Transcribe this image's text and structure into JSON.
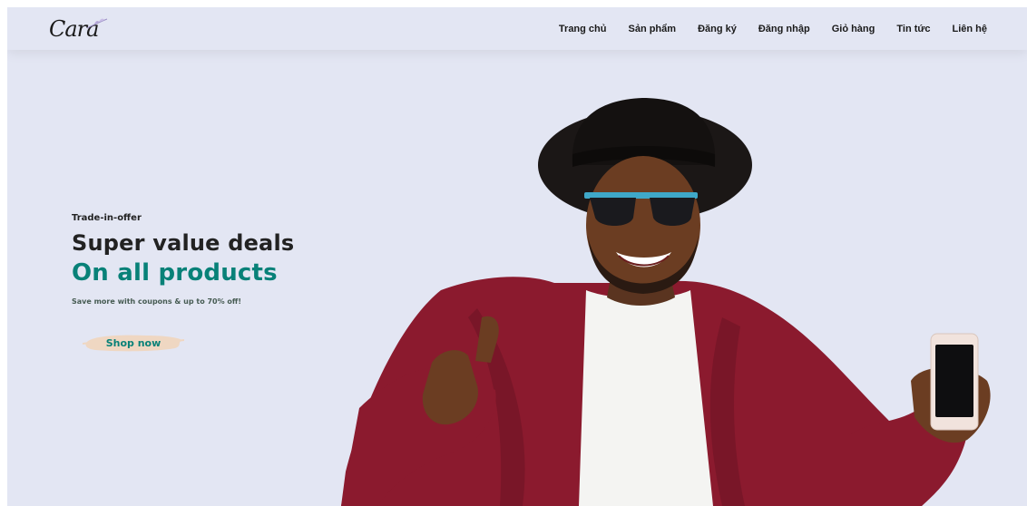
{
  "header": {
    "logo_text": "Cara",
    "nav": [
      {
        "label": "Trang chủ"
      },
      {
        "label": "Sản phẩm"
      },
      {
        "label": "Đăng ký"
      },
      {
        "label": "Đăng nhập"
      },
      {
        "label": "Giỏ hàng"
      },
      {
        "label": "Tin tức"
      },
      {
        "label": "Liên hệ"
      }
    ]
  },
  "hero": {
    "eyebrow": "Trade-in-offer",
    "title_line1": "Super value deals",
    "title_line2": "On all products",
    "subtitle": "Save more with coupons & up to 70% off!",
    "button_label": "Shop now"
  },
  "colors": {
    "background": "#e3e6f3",
    "accent": "#088178",
    "jacket": "#8b1a2e",
    "button_brush": "#efd7c2"
  }
}
